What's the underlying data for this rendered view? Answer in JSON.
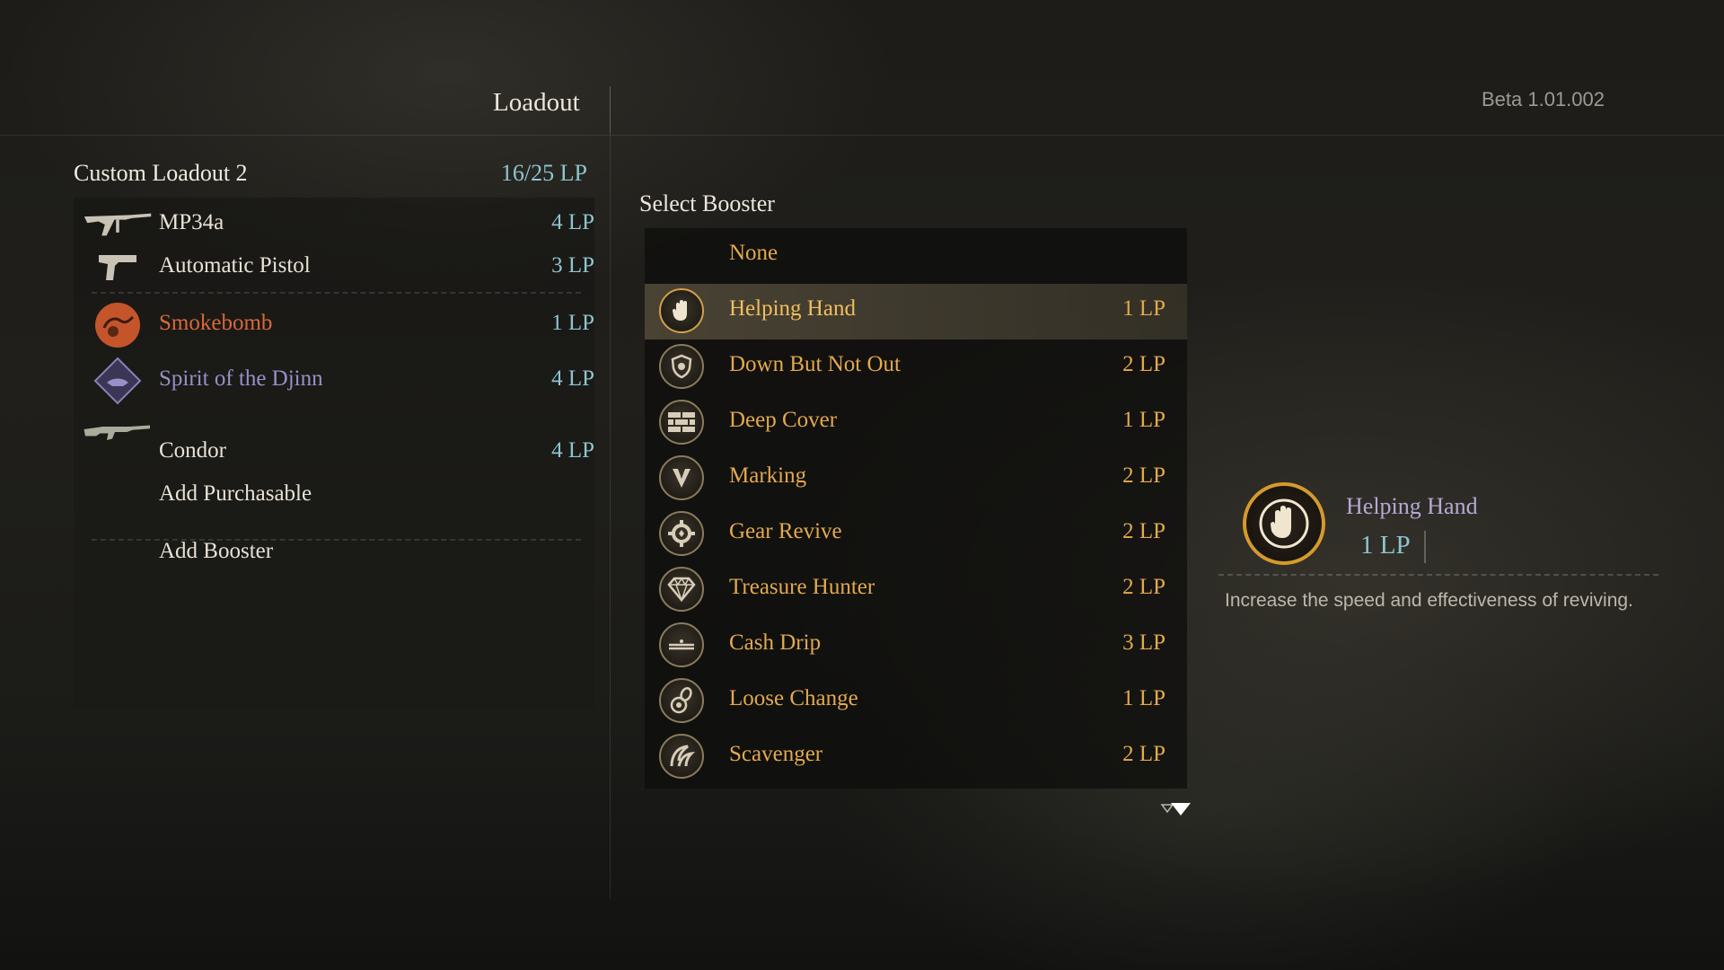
{
  "header": {
    "title": "Loadout",
    "version": "Beta 1.01.002"
  },
  "loadout": {
    "name": "Custom Loadout 2",
    "total_lp": "16/25 LP",
    "items": [
      {
        "name": "MP34a",
        "lp": "4 LP",
        "icon": "smg-icon"
      },
      {
        "name": "Automatic Pistol",
        "lp": "3 LP",
        "icon": "pistol-icon"
      },
      {
        "name": "Smokebomb",
        "lp": "1 LP",
        "icon": "smokebomb-icon",
        "color": "#d9683a"
      },
      {
        "name": "Spirit of the Djinn",
        "lp": "4 LP",
        "icon": "djinn-icon",
        "color": "#9a8fc8"
      },
      {
        "name": "Condor",
        "lp": "4 LP",
        "icon": "rifle-icon"
      },
      {
        "name": "Add Purchasable",
        "lp": ""
      },
      {
        "name": "Add Booster",
        "lp": ""
      }
    ]
  },
  "booster_panel": {
    "title": "Select Booster",
    "boosters": [
      {
        "name": "None",
        "lp": ""
      },
      {
        "name": "Helping Hand",
        "lp": "1 LP",
        "icon": "hand-icon",
        "selected": true
      },
      {
        "name": "Down But Not Out",
        "lp": "2 LP",
        "icon": "shield-icon"
      },
      {
        "name": "Deep Cover",
        "lp": "1 LP",
        "icon": "brick-wall-icon"
      },
      {
        "name": "Marking",
        "lp": "2 LP",
        "icon": "chevron-mark-icon"
      },
      {
        "name": "Gear Revive",
        "lp": "2 LP",
        "icon": "gear-icon"
      },
      {
        "name": "Treasure Hunter",
        "lp": "2 LP",
        "icon": "diamond-icon"
      },
      {
        "name": "Cash Drip",
        "lp": "3 LP",
        "icon": "cash-icon"
      },
      {
        "name": "Loose Change",
        "lp": "1 LP",
        "icon": "coins-icon"
      },
      {
        "name": "Scavenger",
        "lp": "2 LP",
        "icon": "claw-icon"
      }
    ]
  },
  "detail": {
    "name": "Helping Hand",
    "lp": "1 LP",
    "description": "Increase the speed and effectiveness of reviving."
  },
  "colors": {
    "booster_text": "#e2a94d",
    "lp_text": "#8ec5cf",
    "selected_ring": "#d69a2c"
  }
}
